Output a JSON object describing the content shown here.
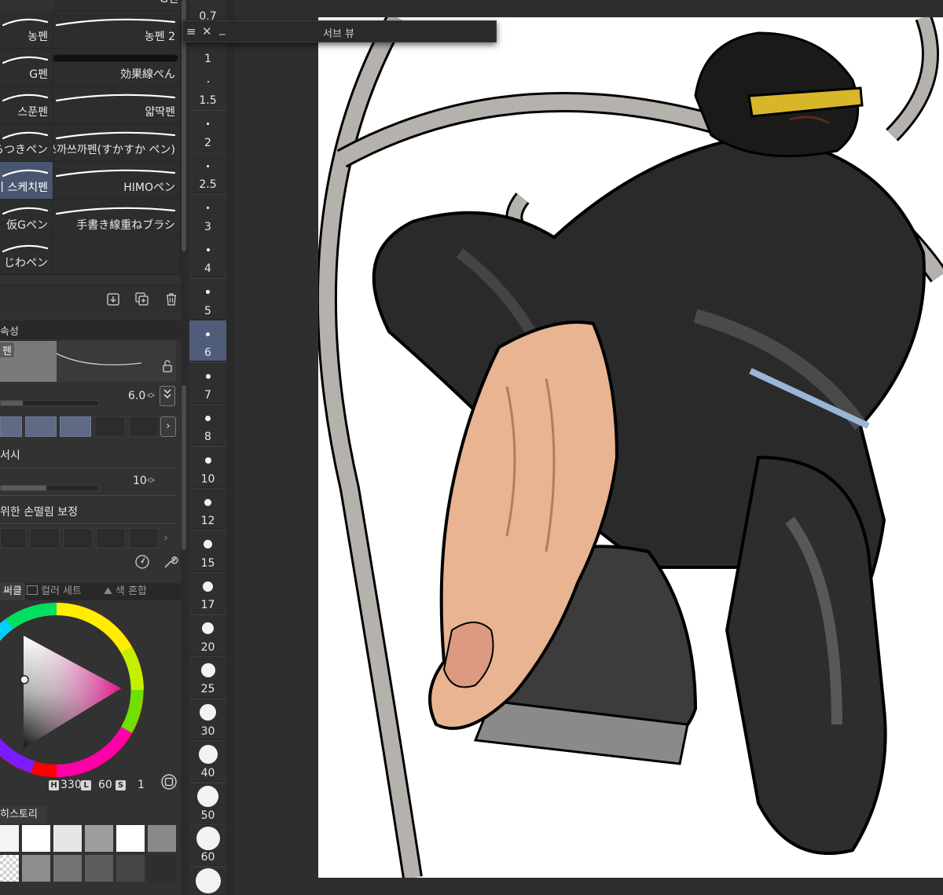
{
  "brushes": [
    {
      "label": "G펜",
      "selected": false,
      "stroke": "#d0d0d0"
    },
    {
      "label": "농펜",
      "selected": false,
      "stroke": "#ffffff"
    },
    {
      "label": "농펜 2",
      "selected": false,
      "stroke": "#ffffff"
    },
    {
      "label": "G펜",
      "selected": false,
      "stroke": "#ffffff"
    },
    {
      "label": "効果線ぺん",
      "selected": false,
      "stroke": "#111111"
    },
    {
      "label": "스푼펜",
      "selected": false,
      "stroke": "#ffffff"
    },
    {
      "label": "얇딱펜",
      "selected": false,
      "stroke": "#ffffff"
    },
    {
      "label": "らつきペン",
      "selected": false,
      "stroke": "#ffffff"
    },
    {
      "label": "쓰까쓰까펜(すかすか ペン)",
      "selected": false,
      "stroke": "#ffffff"
    },
    {
      "label": "이 스케치펜",
      "selected": true,
      "stroke": "#ffffff"
    },
    {
      "label": "HIMOペン",
      "selected": false,
      "stroke": "#ffffff"
    },
    {
      "label": "仮Gペン",
      "selected": false,
      "stroke": "#ffffff"
    },
    {
      "label": "手書き線重ねブラシ",
      "selected": false,
      "stroke": "#ffffff"
    },
    {
      "label": "じわペン",
      "selected": false,
      "stroke": "#ffffff"
    }
  ],
  "brush_toolbar": {
    "icons": [
      "import-icon",
      "duplicate-icon",
      "trash-icon"
    ]
  },
  "tool_property": {
    "header": "속성",
    "preview_label": "펜",
    "size_value": "6.0",
    "stabilization_label": "서시",
    "stabilization_value": "10",
    "hand_shake_label": "위한 손떨림 보정"
  },
  "color_tabs": [
    {
      "label": "써클",
      "active": true
    },
    {
      "label": "컬러 세트",
      "active": false
    },
    {
      "label": "색 혼합",
      "active": false
    }
  ],
  "color": {
    "h_label": "H",
    "h_value": "330",
    "l_label": "L",
    "l_value": "60",
    "s_label": "S",
    "s_value": "1",
    "accent": "#e0128a"
  },
  "history": {
    "header": "히스토리"
  },
  "swatches": [
    "#f4f4f4",
    "#ffffff",
    "#e6e6e6",
    "#9e9e9e",
    "#ffffff",
    "#8a8a8a",
    "#checker",
    "#8e8e8e",
    "#737373",
    "#5c5c5c",
    "#464646",
    "#2e2e2e"
  ],
  "brush_sizes": [
    {
      "label": "0.7",
      "selected": false
    },
    {
      "label": "1",
      "selected": false
    },
    {
      "label": "1.5",
      "selected": false
    },
    {
      "label": "2",
      "selected": false
    },
    {
      "label": "2.5",
      "selected": false
    },
    {
      "label": "3",
      "selected": false
    },
    {
      "label": "4",
      "selected": false
    },
    {
      "label": "5",
      "selected": false
    },
    {
      "label": "6",
      "selected": true
    },
    {
      "label": "7",
      "selected": false
    },
    {
      "label": "8",
      "selected": false
    },
    {
      "label": "10",
      "selected": false
    },
    {
      "label": "12",
      "selected": false
    },
    {
      "label": "15",
      "selected": false
    },
    {
      "label": "17",
      "selected": false
    },
    {
      "label": "20",
      "selected": false
    },
    {
      "label": "25",
      "selected": false
    },
    {
      "label": "30",
      "selected": false
    },
    {
      "label": "40",
      "selected": false
    },
    {
      "label": "50",
      "selected": false
    },
    {
      "label": "60",
      "selected": false
    },
    {
      "label": "",
      "selected": false
    }
  ],
  "subview": {
    "title": "서브 뷰",
    "menu_icon": "≡",
    "close_icon": "✕",
    "minimize_icon": "_"
  }
}
